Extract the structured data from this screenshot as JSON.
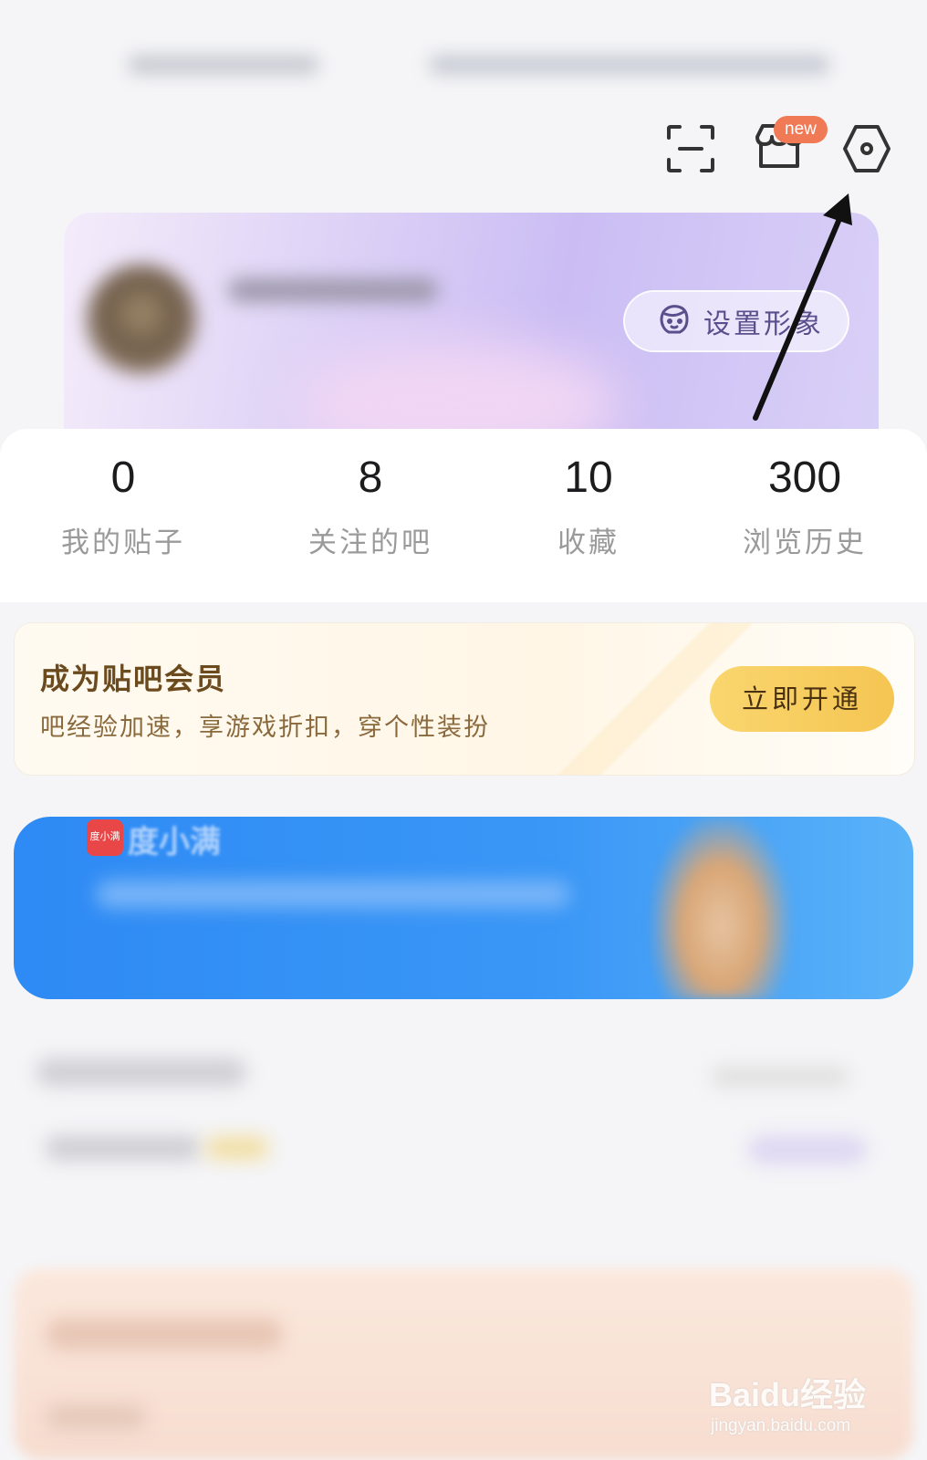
{
  "toolbar": {
    "icons": [
      "scan-icon",
      "shop-icon",
      "settings-icon"
    ],
    "new_badge": "new"
  },
  "profile": {
    "set_avatar_label": "设置形象"
  },
  "stats": [
    {
      "value": "0",
      "label": "我的贴子"
    },
    {
      "value": "8",
      "label": "关注的吧"
    },
    {
      "value": "10",
      "label": "收藏"
    },
    {
      "value": "300",
      "label": "浏览历史"
    }
  ],
  "membership": {
    "title": "成为贴吧会员",
    "subtitle": "吧经验加速，享游戏折扣，穿个性装扮",
    "button": "立即开通"
  },
  "ad": {
    "logo_text": "度小满",
    "brand": "度小满"
  },
  "watermark": {
    "text": "Baidu经验",
    "url": "jingyan.baidu.com"
  },
  "colors": {
    "accent_purple": "#cbbdf4",
    "member_button": "#f5c552",
    "ad_blue": "#2e8af4",
    "new_badge": "#f07a55"
  }
}
